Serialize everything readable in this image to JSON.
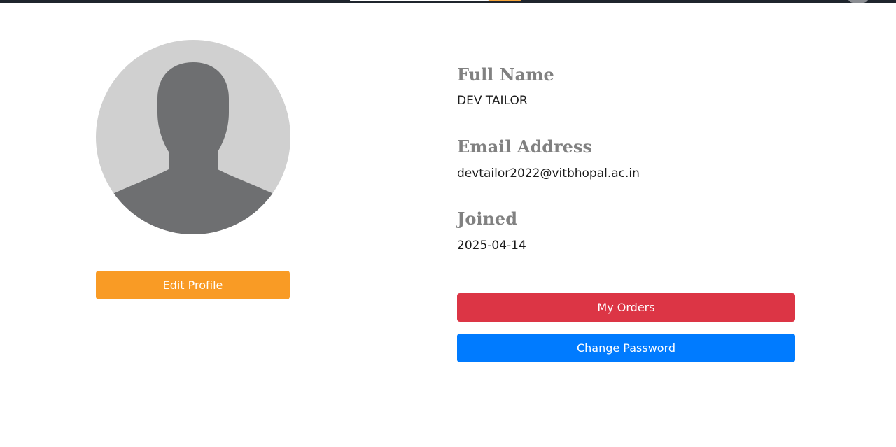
{
  "header": {
    "colors": {
      "bar": "#1f252d",
      "search_button": "#f5a53a"
    }
  },
  "profile": {
    "avatar_icon": "default-user-avatar-icon",
    "edit_button_label": "Edit Profile",
    "fields": [
      {
        "label": "Full Name",
        "value": "DEV TAILOR"
      },
      {
        "label": "Email Address",
        "value": "devtailor2022@vitbhopal.ac.in"
      },
      {
        "label": "Joined",
        "value": "2025-04-14"
      }
    ],
    "actions": {
      "orders_label": "My Orders",
      "password_label": "Change Password"
    }
  },
  "colors": {
    "edit_button": "#f99b25",
    "orders_button": "#dc3545",
    "password_button": "#007bff",
    "label_text": "#818181",
    "value_text": "#1b1b1b",
    "avatar_bg": "#d0d0d0",
    "avatar_figure": "#6e6f71"
  }
}
